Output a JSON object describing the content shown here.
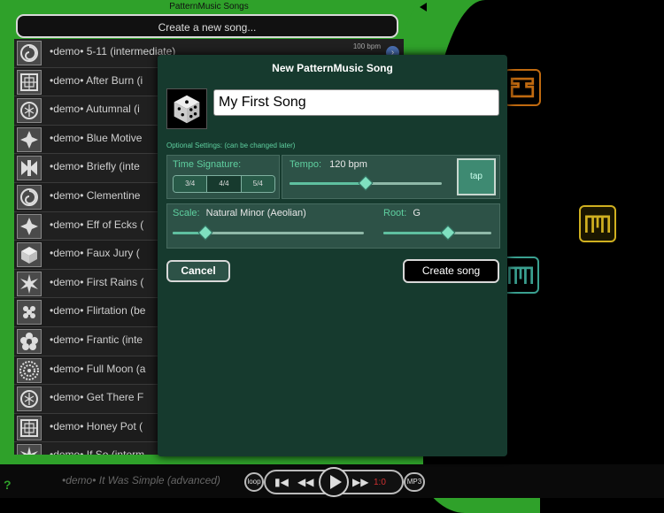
{
  "song_list": {
    "title": "PatternMusic Songs",
    "create_label": "Create a new song...",
    "items": [
      {
        "label": "•demo• 5-11 (intermediate)",
        "bpm": "100 bpm",
        "icon": "spiral-icon"
      },
      {
        "label": "•demo• After Burn (i",
        "icon": "grid-square-icon"
      },
      {
        "label": "•demo• Autumnal (i",
        "icon": "circle-knot-icon"
      },
      {
        "label": "•demo• Blue Motive",
        "icon": "diamond-star-icon"
      },
      {
        "label": "•demo• Briefly (inte",
        "icon": "bowtie-icon"
      },
      {
        "label": "•demo• Clementine",
        "icon": "spiral-icon"
      },
      {
        "label": "•demo• Eff of Ecks (",
        "icon": "diamond-star-icon"
      },
      {
        "label": "•demo• Faux Jury (",
        "icon": "dice-icon"
      },
      {
        "label": "•demo• First Rains (",
        "icon": "star-burst-icon"
      },
      {
        "label": "•demo• Flirtation (be",
        "icon": "dots-cluster-icon"
      },
      {
        "label": "•demo• Frantic (inte",
        "icon": "flower-icon"
      },
      {
        "label": "•demo• Full Moon (a",
        "icon": "mandala-icon"
      },
      {
        "label": "•demo• Get There F",
        "icon": "circle-knot-icon"
      },
      {
        "label": "•demo• Honey Pot (",
        "icon": "grid-square-icon"
      },
      {
        "label": "•demo• If So (interm",
        "icon": "star-burst-icon"
      }
    ]
  },
  "transport": {
    "now_playing": "•demo• It Was Simple (advanced)",
    "loop_label": "loop",
    "counter": "1:0",
    "mp3_label": "MP3",
    "help": "?"
  },
  "modal": {
    "title": "New PatternMusic Song",
    "song_name": "My First Song",
    "optional_label": "Optional Settings: (can be changed later)",
    "time_signature": {
      "label": "Time Signature:",
      "options": [
        "3/4",
        "4/4",
        "5/4"
      ],
      "selected": "4/4"
    },
    "tempo": {
      "label": "Tempo:",
      "value": "120 bpm",
      "level": 0.5,
      "tap_label": "tap"
    },
    "scale": {
      "label": "Scale:",
      "value": "Natural Minor (Aeolian)",
      "level": 0.17
    },
    "root": {
      "label": "Root:",
      "value": "G",
      "level": 0.6
    },
    "cancel_label": "Cancel",
    "create_label": "Create song"
  },
  "colors": {
    "frame_green": "#2fa12a",
    "modal_bg": "#163a2e",
    "accent_teal": "#5fd0a0"
  }
}
